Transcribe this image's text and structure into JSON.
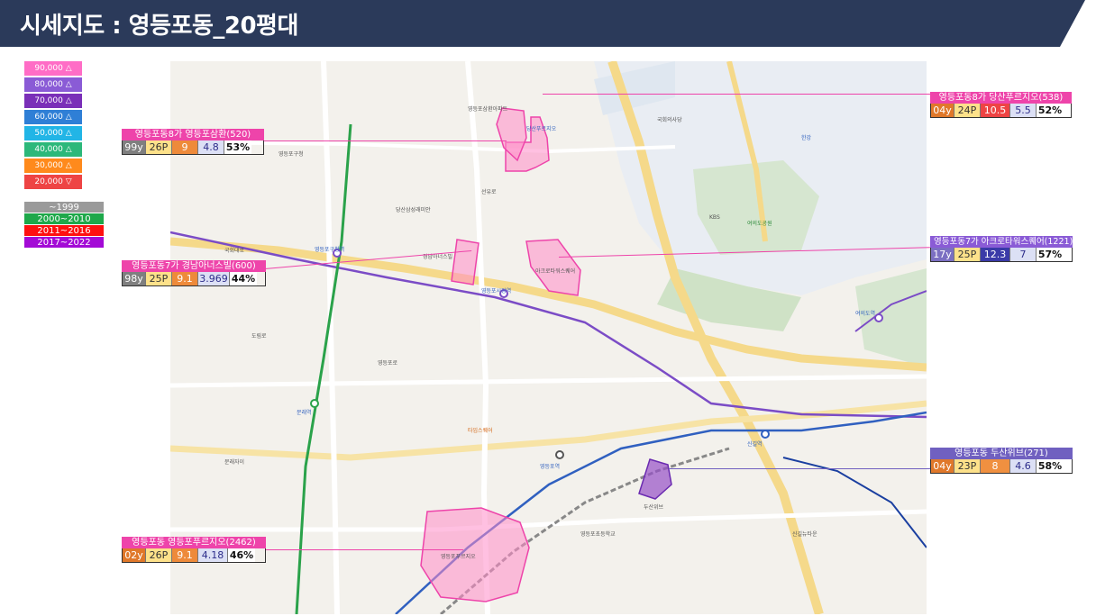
{
  "header": {
    "title": "시세지도 : 영등포동_20평대",
    "bg_color": "#2b3a5a"
  },
  "price_legend": [
    {
      "label": "90,000 △",
      "color": "#ff6dc6"
    },
    {
      "label": "80,000 △",
      "color": "#8a5bd6"
    },
    {
      "label": "70,000 △",
      "color": "#7a2fb8"
    },
    {
      "label": "60,000 △",
      "color": "#2f7fd6"
    },
    {
      "label": "50,000 △",
      "color": "#22b5e6"
    },
    {
      "label": "40,000 △",
      "color": "#2cb87a"
    },
    {
      "label": "30,000 △",
      "color": "#ff8a1c"
    },
    {
      "label": "20,000 ▽",
      "color": "#ee4444"
    }
  ],
  "year_legend": [
    {
      "label": "~1999",
      "color": "#9a9a9a"
    },
    {
      "label": "2000~2010",
      "color": "#1ea84a"
    },
    {
      "label": "2011~2016",
      "color": "#ff1010"
    },
    {
      "label": "2017~2022",
      "color": "#a30ad6"
    }
  ],
  "callouts": [
    {
      "id": "c1",
      "title": "영등포동8가 영등포삼환(520)",
      "title_color": "#ee44aa",
      "year": "99y",
      "year_style": "old",
      "py": "26P",
      "price": "9",
      "price_color": "#ee8a3a",
      "jeonse": "4.8",
      "rate": "53%"
    },
    {
      "id": "c2",
      "title": "영등포동8가 당산푸르지오(538)",
      "title_color": "#ee44aa",
      "year": "04y",
      "year_style": "new",
      "py": "24P",
      "price": "10.5",
      "price_color": "#ee4444",
      "jeonse": "5.5",
      "rate": "52%"
    },
    {
      "id": "c3",
      "title": "영등포동7가 경남아너스빌(600)",
      "title_color": "#ee44aa",
      "year": "98y",
      "year_style": "old",
      "py": "25P",
      "price": "9.1",
      "price_color": "#ee8a3a",
      "jeonse": "3.969",
      "rate": "44%"
    },
    {
      "id": "c4",
      "title": "영등포동7가 아크로타워스퀘어(1221)",
      "title_color": "#8a5bd6",
      "year": "17y",
      "year_style": "mid",
      "py": "25P",
      "price": "12.3",
      "price_color": "#3a3aa8",
      "jeonse": "7",
      "rate": "57%"
    },
    {
      "id": "c5",
      "title": "영등포동 두산위브(271)",
      "title_color": "#7060c0",
      "year": "04y",
      "year_style": "new",
      "py": "23P",
      "price": "8",
      "price_color": "#f09040",
      "jeonse": "4.6",
      "rate": "58%"
    },
    {
      "id": "c6",
      "title": "영등포동 영등포푸르지오(2462)",
      "title_color": "#ee44aa",
      "year": "02y",
      "year_style": "new",
      "py": "26P",
      "price": "9.1",
      "price_color": "#ee8a3a",
      "jeonse": "4.18",
      "rate": "46%"
    }
  ],
  "map_labels": [
    {
      "text": "당산푸르지오",
      "cls": "blue"
    },
    {
      "text": "영등포삼환아파트",
      "cls": ""
    },
    {
      "text": "영등포구청",
      "cls": ""
    },
    {
      "text": "영등포구청역",
      "cls": "blue"
    },
    {
      "text": "당산삼성래미안",
      "cls": ""
    },
    {
      "text": "경남아너스빌",
      "cls": ""
    },
    {
      "text": "아크로타워스퀘어",
      "cls": ""
    },
    {
      "text": "국회의사당",
      "cls": ""
    },
    {
      "text": "KBS",
      "cls": ""
    },
    {
      "text": "여의도공원",
      "cls": "green"
    },
    {
      "text": "영등포시장역",
      "cls": "blue"
    },
    {
      "text": "문래역",
      "cls": "blue"
    },
    {
      "text": "영등포역",
      "cls": "blue"
    },
    {
      "text": "영등포푸르지오",
      "cls": ""
    },
    {
      "text": "두산위브",
      "cls": ""
    },
    {
      "text": "신길역",
      "cls": "blue"
    },
    {
      "text": "타임스퀘어",
      "cls": "orange"
    },
    {
      "text": "여의도역",
      "cls": "blue"
    },
    {
      "text": "문래자이",
      "cls": ""
    },
    {
      "text": "영등포초등학교",
      "cls": ""
    },
    {
      "text": "신길뉴타운",
      "cls": ""
    },
    {
      "text": "한강",
      "cls": "blue"
    },
    {
      "text": "국회대로",
      "cls": ""
    },
    {
      "text": "영등포로",
      "cls": ""
    },
    {
      "text": "선유로",
      "cls": ""
    },
    {
      "text": "도림로",
      "cls": ""
    }
  ]
}
